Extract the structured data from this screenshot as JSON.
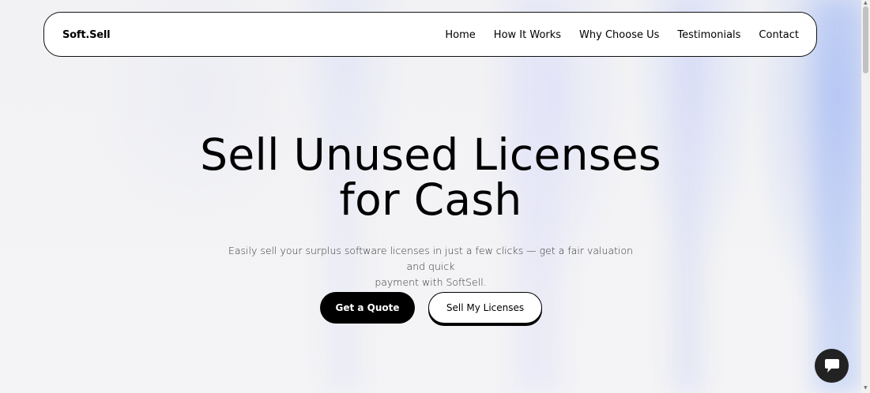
{
  "nav": {
    "logo": "Soft.Sell",
    "links": [
      "Home",
      "How It Works",
      "Why Choose Us",
      "Testimonials",
      "Contact"
    ]
  },
  "hero": {
    "title_line1": "Sell Unused Licenses",
    "title_line2": "for Cash",
    "subtitle_line1": "Easily sell your surplus software licenses in just a few clicks — get a fair valuation and quick",
    "subtitle_line2": "payment with SoftSell.",
    "primary_button": "Get a Quote",
    "secondary_button": "Sell My Licenses"
  },
  "chat": {
    "icon": "chat-bubble-icon"
  }
}
